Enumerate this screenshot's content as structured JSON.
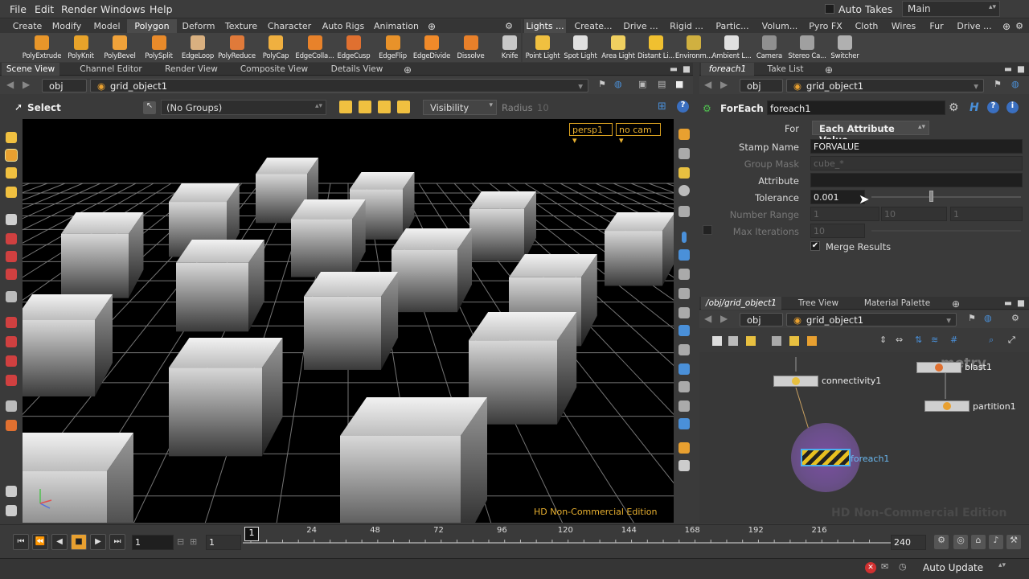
{
  "menubar": {
    "items": [
      "File",
      "Edit",
      "Render",
      "Windows",
      "Help"
    ],
    "auto_takes": "Auto Takes",
    "desktop": "Main"
  },
  "shelf_left": {
    "tabs": [
      "Create",
      "Modify",
      "Model",
      "Polygon",
      "Deform",
      "Texture",
      "Character",
      "Auto Rigs",
      "Animation"
    ],
    "active_tab": "Polygon",
    "tools": [
      {
        "label": "PolyExtrude",
        "icon": "polyextrude-icon",
        "color": "#e8962a"
      },
      {
        "label": "PolyKnit",
        "icon": "polyknit-icon",
        "color": "#e8a32a"
      },
      {
        "label": "PolyBevel",
        "icon": "polybevel-icon",
        "color": "#f0a23a"
      },
      {
        "label": "PolySplit",
        "icon": "polysplit-icon",
        "color": "#e88a2a"
      },
      {
        "label": "EdgeLoop",
        "icon": "edgeloop-icon",
        "color": "#d9b080"
      },
      {
        "label": "PolyReduce",
        "icon": "polyreduce-icon",
        "color": "#e07a3a"
      },
      {
        "label": "PolyCap",
        "icon": "polycap-icon",
        "color": "#f0b040"
      },
      {
        "label": "EdgeColla...",
        "icon": "edgecollapse-icon",
        "color": "#e8822a"
      },
      {
        "label": "EdgeCusp",
        "icon": "edgecusp-icon",
        "color": "#e07030"
      },
      {
        "label": "EdgeFlip",
        "icon": "edgeflip-icon",
        "color": "#e8922a"
      },
      {
        "label": "EdgeDivide",
        "icon": "edgedivide-icon",
        "color": "#f08a2a"
      },
      {
        "label": "Dissolve",
        "icon": "dissolve-icon",
        "color": "#e8802a"
      },
      {
        "label": "Knife",
        "icon": "knife-icon",
        "color": "#c8c8c8"
      }
    ]
  },
  "shelf_right": {
    "tabs": [
      "Lights ...",
      "Create...",
      "Drive ...",
      "Rigid ...",
      "Partic...",
      "Volum...",
      "Pyro FX",
      "Cloth",
      "Wires",
      "Fur",
      "Drive ..."
    ],
    "active_tab": "Lights ...",
    "tools": [
      {
        "label": "Point Light",
        "icon": "point-light-icon",
        "color": "#f0c040"
      },
      {
        "label": "Spot Light",
        "icon": "spot-light-icon",
        "color": "#e0e0e0"
      },
      {
        "label": "Area Light",
        "icon": "area-light-icon",
        "color": "#f0d060"
      },
      {
        "label": "Distant Li...",
        "icon": "distant-light-icon",
        "color": "#f0c030"
      },
      {
        "label": "Environm...",
        "icon": "environment-light-icon",
        "color": "#d0b040"
      },
      {
        "label": "Ambient L...",
        "icon": "ambient-light-icon",
        "color": "#e0e0e0"
      },
      {
        "label": "Camera",
        "icon": "camera-icon",
        "color": "#909090"
      },
      {
        "label": "Stereo Ca...",
        "icon": "stereo-camera-icon",
        "color": "#a0a0a0"
      },
      {
        "label": "Switcher",
        "icon": "switcher-icon",
        "color": "#b0b0b0"
      }
    ]
  },
  "scene_pane": {
    "tabs": [
      "Scene View",
      "Channel Editor",
      "Render View",
      "Composite View",
      "Details View"
    ],
    "active_tab": "Scene View",
    "path": [
      "obj",
      "grid_object1"
    ],
    "select_label": "Select",
    "groups": "(No Groups)",
    "visibility": "Visibility",
    "radius_label": "Radius",
    "radius_value": "10",
    "persp": "persp1",
    "cam": "no cam",
    "watermark": "HD Non-Commercial Edition"
  },
  "params_pane": {
    "tabs": [
      "foreach1",
      "Take List"
    ],
    "path": [
      "obj",
      "grid_object1"
    ],
    "node_type": "ForEach",
    "node_name": "foreach1",
    "params": {
      "for_label": "For",
      "for_value": "Each Attribute Value",
      "stamp_label": "Stamp Name",
      "stamp_value": "FORVALUE",
      "group_mask_label": "Group Mask",
      "group_mask_value": "cube_*",
      "attribute_label": "Attribute",
      "attribute_value": "",
      "tolerance_label": "Tolerance",
      "tolerance_value": "0.001",
      "number_range_label": "Number Range",
      "number_range_values": [
        "1",
        "10",
        "1"
      ],
      "max_iter_label": "Max Iterations",
      "max_iter_value": "10",
      "merge_label": "Merge Results"
    }
  },
  "network_pane": {
    "tabs": [
      "/obj/grid_object1",
      "Tree View",
      "Material Palette"
    ],
    "path": [
      "obj",
      "grid_object1"
    ],
    "nodes": {
      "connectivity": "connectivity1",
      "blast": "blast1",
      "partition": "partition1",
      "foreach": "foreach1"
    },
    "context_label": "metry",
    "watermark": "HD Non-Commercial Edition"
  },
  "timeline": {
    "current_frame": "1",
    "start_frame": "1",
    "end_frame": "240",
    "frame_marker": "1",
    "ticks": [
      "24",
      "48",
      "72",
      "96",
      "120",
      "144",
      "168",
      "192",
      "216"
    ],
    "tick_values": [
      24,
      48,
      72,
      96,
      120,
      144,
      168,
      192,
      216
    ]
  },
  "statusbar": {
    "auto_update": "Auto Update"
  }
}
